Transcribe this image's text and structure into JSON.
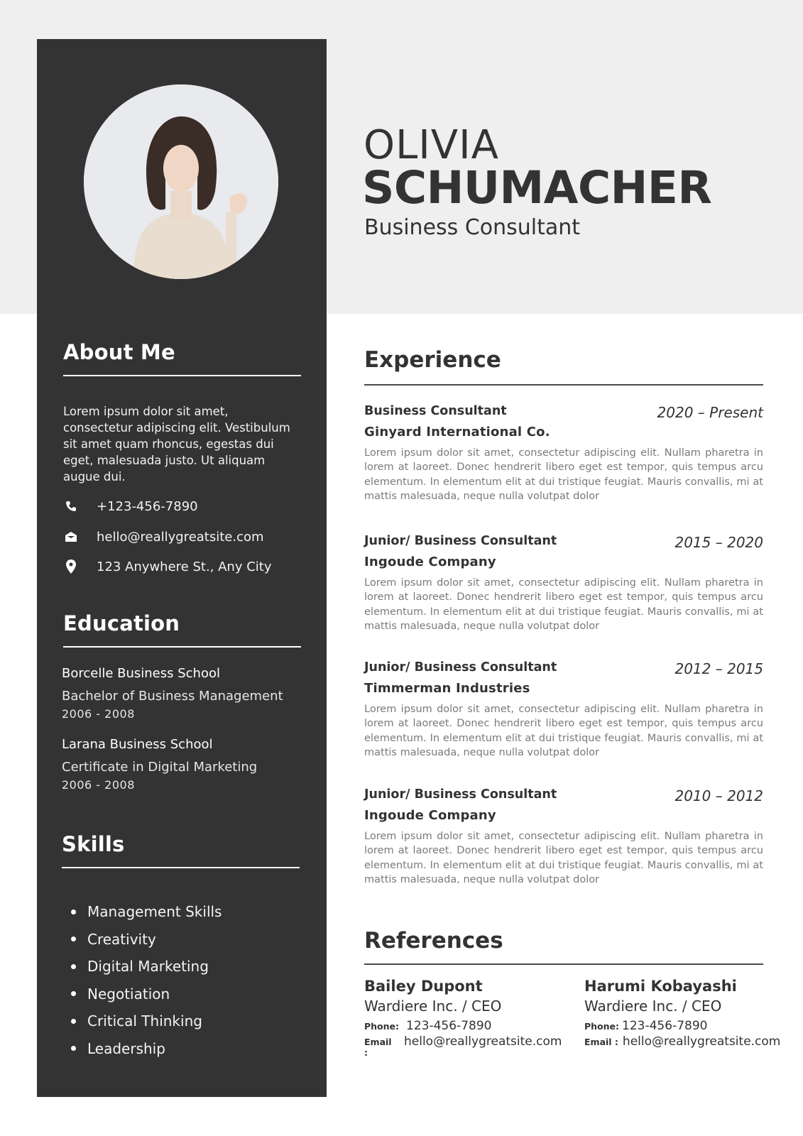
{
  "person": {
    "first_name": "OLIVIA",
    "last_name": "SCHUMACHER",
    "title": "Business Consultant",
    "photo_icon": "profile-photo"
  },
  "sidebar": {
    "about": {
      "heading": "About Me",
      "text": "Lorem ipsum dolor sit amet, consectetur adipiscing elit. Vestibulum sit amet quam rhoncus, egestas dui eget, malesuada justo. Ut aliquam augue dui."
    },
    "contacts": [
      {
        "icon": "phone-icon",
        "text": "+123-456-7890"
      },
      {
        "icon": "envelope-icon",
        "text": "hello@reallygreatsite.com"
      },
      {
        "icon": "map-pin-icon",
        "text": "123 Anywhere St., Any City"
      }
    ],
    "education": {
      "heading": "Education",
      "items": [
        {
          "school": "Borcelle Business School",
          "degree": "Bachelor of Business Management",
          "years": "2006 - 2008"
        },
        {
          "school": "Larana Business School",
          "degree": "Certificate in Digital Marketing",
          "years": "2006 - 2008"
        }
      ]
    },
    "skills": {
      "heading": "Skills",
      "items": [
        "Management Skills",
        "Creativity",
        "Digital Marketing",
        "Negotiation",
        "Critical Thinking",
        "Leadership"
      ]
    }
  },
  "experience": {
    "heading": "Experience",
    "items": [
      {
        "role": "Business Consultant",
        "dates": "2020 – Present",
        "company": "Ginyard International Co.",
        "description": "Lorem ipsum dolor sit amet, consectetur adipiscing elit. Nullam pharetra in lorem at laoreet. Donec hendrerit libero eget est tempor, quis tempus arcu elementum. In elementum elit at dui tristique feugiat. Mauris convallis, mi at mattis malesuada, neque nulla volutpat dolor"
      },
      {
        "role": "Junior/ Business Consultant",
        "dates": "2015 – 2020",
        "company": "Ingoude Company",
        "description": "Lorem ipsum dolor sit amet, consectetur adipiscing elit. Nullam pharetra in lorem at laoreet. Donec hendrerit libero eget est tempor, quis tempus arcu elementum. In elementum elit at dui tristique feugiat. Mauris convallis, mi at mattis malesuada, neque nulla volutpat dolor"
      },
      {
        "role": "Junior/ Business Consultant",
        "dates": "2012 – 2015",
        "company": "Timmerman Industries",
        "description": "Lorem ipsum dolor sit amet, consectetur adipiscing elit. Nullam pharetra in lorem at laoreet. Donec hendrerit libero eget est tempor, quis tempus arcu elementum. In elementum elit at dui tristique feugiat. Mauris convallis, mi at mattis malesuada, neque nulla volutpat dolor"
      },
      {
        "role": "Junior/ Business Consultant",
        "dates": "2010 – 2012",
        "company": "Ingoude Company",
        "description": "Lorem ipsum dolor sit amet, consectetur adipiscing elit. Nullam pharetra in lorem at laoreet. Donec hendrerit libero eget est tempor, quis tempus arcu elementum. In elementum elit at dui tristique feugiat. Mauris convallis, mi at mattis malesuada, neque nulla volutpat dolor"
      }
    ]
  },
  "references": {
    "heading": "References",
    "phone_label": "Phone:",
    "email_label": "Email :",
    "items": [
      {
        "name": "Bailey Dupont",
        "company": "Wardiere Inc. / CEO",
        "phone": "123-456-7890",
        "email": "hello@reallygreatsite.com"
      },
      {
        "name": "Harumi Kobayashi",
        "company": "Wardiere Inc. / CEO",
        "phone": "123-456-7890",
        "email": "hello@reallygreatsite.com"
      }
    ]
  }
}
